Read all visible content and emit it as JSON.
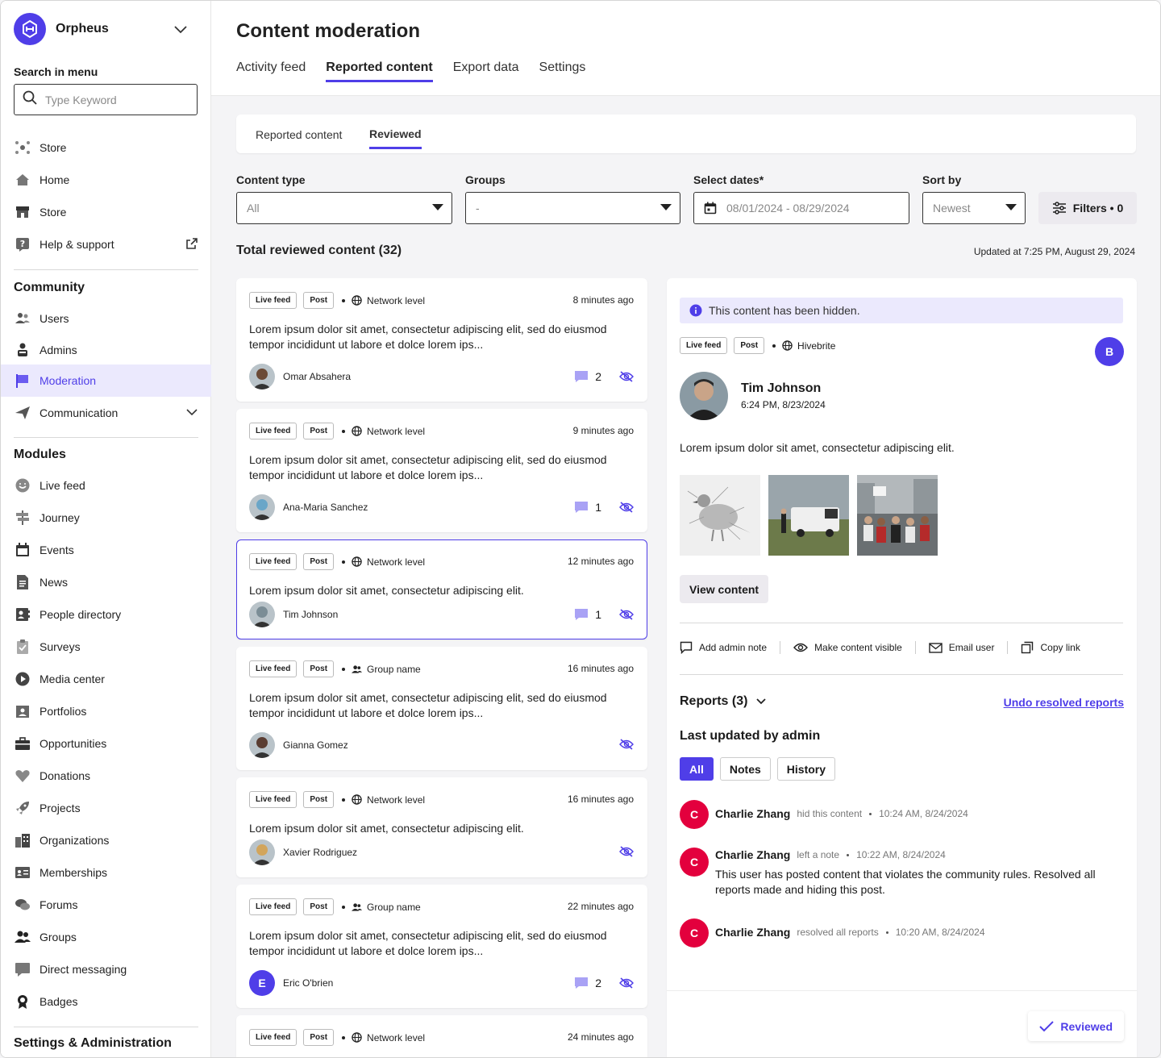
{
  "app": {
    "name": "Orpheus"
  },
  "sidebar": {
    "search_label": "Search in menu",
    "search_placeholder": "Type Keyword",
    "top_items": [
      {
        "label": "Store"
      },
      {
        "label": "Home"
      },
      {
        "label": "Store"
      },
      {
        "label": "Help & support"
      }
    ],
    "community_title": "Community",
    "community_items": [
      {
        "label": "Users"
      },
      {
        "label": "Admins"
      },
      {
        "label": "Moderation"
      },
      {
        "label": "Communication"
      }
    ],
    "modules_title": "Modules",
    "module_items": [
      {
        "label": "Live feed"
      },
      {
        "label": "Journey"
      },
      {
        "label": "Events"
      },
      {
        "label": "News"
      },
      {
        "label": "People directory"
      },
      {
        "label": "Surveys"
      },
      {
        "label": "Media center"
      },
      {
        "label": "Portfolios"
      },
      {
        "label": "Opportunities"
      },
      {
        "label": "Donations"
      },
      {
        "label": "Projects"
      },
      {
        "label": "Organizations"
      },
      {
        "label": "Memberships"
      },
      {
        "label": "Forums"
      },
      {
        "label": "Groups"
      },
      {
        "label": "Direct messaging"
      },
      {
        "label": "Badges"
      }
    ],
    "settings_title": "Settings & Administration"
  },
  "header": {
    "title": "Content moderation",
    "tabs": [
      "Activity feed",
      "Reported content",
      "Export data",
      "Settings"
    ],
    "active_tab": "Reported content"
  },
  "subtabs": [
    "Reported content",
    "Reviewed"
  ],
  "filters": {
    "content_type_label": "Content type",
    "content_type_value": "All",
    "groups_label": "Groups",
    "groups_value": "-",
    "dates_label": "Select dates*",
    "dates_value": "08/01/2024 - 08/29/2024",
    "sort_label": "Sort by",
    "sort_value": "Newest",
    "filters_button": "Filters • 0"
  },
  "list": {
    "total_label": "Total reviewed content (32)",
    "updated_at": "Updated at 7:25 PM, August 29, 2024",
    "cards": [
      {
        "tag1": "Live feed",
        "tag2": "Post",
        "scope": "Network level",
        "time": "8 minutes ago",
        "text": "Lorem ipsum dolor sit amet, consectetur adipiscing elit, sed do eiusmod tempor incididunt ut labore et dolce lorem ips...",
        "author": "Omar Absahera",
        "comments": "2"
      },
      {
        "tag1": "Live feed",
        "tag2": "Post",
        "scope": "Network level",
        "time": "9 minutes ago",
        "text": "Lorem ipsum dolor sit amet, consectetur adipiscing elit, sed do eiusmod tempor incididunt ut labore et dolce lorem ips...",
        "author": "Ana-Maria Sanchez",
        "comments": "1"
      },
      {
        "tag1": "Live feed",
        "tag2": "Post",
        "scope": "Network level",
        "time": "12 minutes ago",
        "text": "Lorem ipsum dolor sit amet, consectetur adipiscing elit.",
        "author": "Tim Johnson",
        "comments": "1"
      },
      {
        "tag1": "Live feed",
        "tag2": "Post",
        "scope": "Group name",
        "time": "16 minutes ago",
        "text": "Lorem ipsum dolor sit amet, consectetur adipiscing elit, sed do eiusmod tempor incididunt ut labore et dolce lorem ips...",
        "author": "Gianna Gomez",
        "comments": ""
      },
      {
        "tag1": "Live feed",
        "tag2": "Post",
        "scope": "Network level",
        "time": "16 minutes ago",
        "text": "Lorem ipsum dolor sit amet, consectetur adipiscing elit.",
        "author": "Xavier Rodriguez",
        "comments": ""
      },
      {
        "tag1": "Live feed",
        "tag2": "Post",
        "scope": "Group name",
        "time": "22 minutes ago",
        "text": "Lorem ipsum dolor sit amet, consectetur adipiscing elit, sed do eiusmod tempor incididunt ut labore et dolce lorem ips...",
        "author": "Eric O'brien",
        "author_initial": "E",
        "comments": "2"
      },
      {
        "tag1": "Live feed",
        "tag2": "Post",
        "scope": "Network level",
        "time": "24 minutes ago"
      }
    ]
  },
  "detail": {
    "hidden_banner": "This content has been hidden.",
    "tag1": "Live feed",
    "tag2": "Post",
    "scope": "Hivebrite",
    "badge": "B",
    "author": "Tim Johnson",
    "date": "6:24 PM, 8/23/2024",
    "text": "Lorem ipsum dolor sit amet, consectetur adipiscing elit.",
    "view_button": "View content",
    "actions": [
      "Add admin note",
      "Make content visible",
      "Email user",
      "Copy link"
    ],
    "reports_label": "Reports (3)",
    "undo_label": "Undo resolved reports",
    "last_updated_label": "Last updated by admin",
    "chips": [
      "All",
      "Notes",
      "History"
    ],
    "history": [
      {
        "initial": "C",
        "who": "Charlie Zhang",
        "what": "hid this content",
        "when": "10:24 AM, 8/24/2024",
        "note": ""
      },
      {
        "initial": "C",
        "who": "Charlie Zhang",
        "what": "left a note",
        "when": "10:22 AM, 8/24/2024",
        "note": "This user has posted content that violates the community rules. Resolved all reports made and hiding this post."
      },
      {
        "initial": "C",
        "who": "Charlie Zhang",
        "what": "resolved all reports",
        "when": "10:20 AM, 8/24/2024",
        "note": ""
      }
    ],
    "reviewed_button": "Reviewed"
  },
  "colors": {
    "accent": "#4f3ee8",
    "accent_soft": "#ebe9fd",
    "danger": "#e3003d"
  }
}
